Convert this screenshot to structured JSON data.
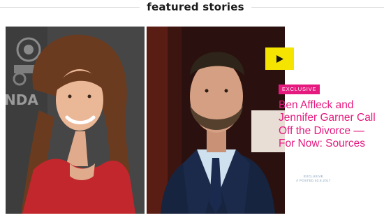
{
  "section": {
    "title": "featured stories"
  },
  "story": {
    "badge": "EXCLUSIVE",
    "headline": "Ben Affleck and Jennifer Garner Call Off the Divorce — For Now: Sources",
    "author": "Exclusive",
    "posted": "// POSTED 03.8.2017",
    "left_photo_sign_text": "NDA"
  },
  "icons": {
    "play": "play-icon"
  },
  "colors": {
    "accent": "#e5197e",
    "play_button": "#f5e400",
    "byline": "#7a9bb8"
  }
}
